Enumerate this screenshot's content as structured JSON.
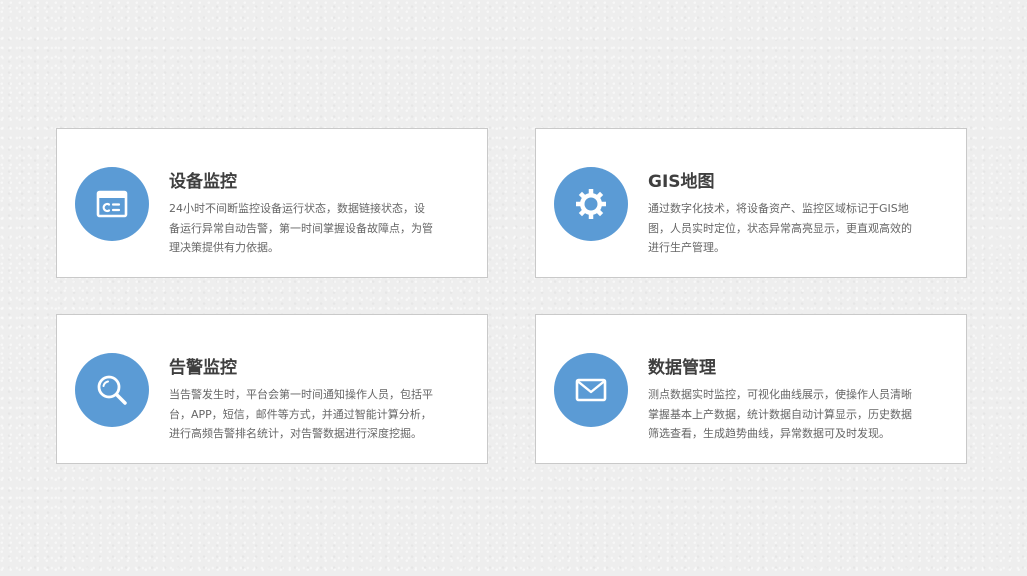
{
  "colors": {
    "accent": "#5b9bd5",
    "title": "#3f3f3f",
    "text": "#666666",
    "card_background": "#ffffff",
    "card_border": "#c9c9c9",
    "page_background": "#eeeeee"
  },
  "cards": [
    {
      "icon": "monitor-panel-icon",
      "title": "设备监控",
      "description": "24小时不间断监控设备运行状态，数据链接状态，设备运行异常自动告警，第一时间掌握设备故障点，为管理决策提供有力依据。"
    },
    {
      "icon": "gear-icon",
      "title": "GIS地图",
      "description": "通过数字化技术，将设备资产、监控区域标记于GIS地图，人员实时定位，状态异常高亮显示，更直观高效的进行生产管理。"
    },
    {
      "icon": "search-icon",
      "title": "告警监控",
      "description": "当告警发生时，平台会第一时间通知操作人员，包括平台，APP，短信，邮件等方式，并通过智能计算分析，进行高频告警排名统计，对告警数据进行深度挖掘。"
    },
    {
      "icon": "mail-icon",
      "title": "数据管理",
      "description": "测点数据实时监控，可视化曲线展示，使操作人员清晰掌握基本上产数据，统计数据自动计算显示，历史数据筛选查看，生成趋势曲线，异常数据可及时发现。"
    }
  ]
}
